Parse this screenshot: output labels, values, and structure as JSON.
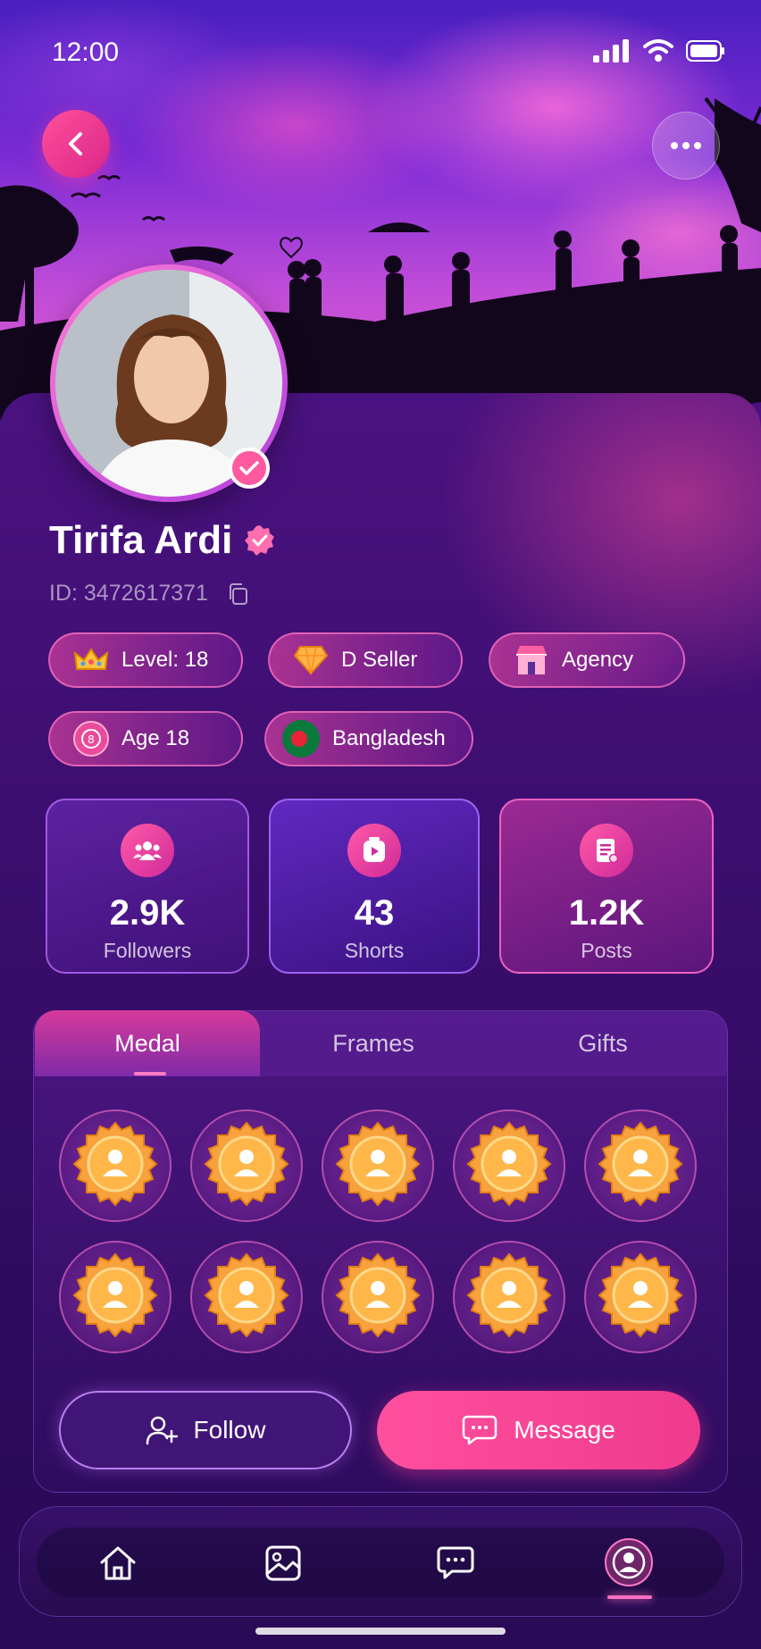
{
  "status_bar": {
    "time": "12:00"
  },
  "profile": {
    "name": "Tirifa Ardi",
    "id_text": "ID: 3472617371"
  },
  "chips": [
    {
      "label": "Level: 18",
      "icon": "crown-icon"
    },
    {
      "label": "D Seller",
      "icon": "diamond-icon"
    },
    {
      "label": "Agency",
      "icon": "store-icon"
    },
    {
      "label": "Age 18",
      "icon": "age-icon"
    },
    {
      "label": "Bangladesh",
      "icon": "flag-icon"
    }
  ],
  "stats": [
    {
      "value": "2.9K",
      "label": "Followers",
      "icon": "users-icon"
    },
    {
      "value": "43",
      "label": "Shorts",
      "icon": "video-icon"
    },
    {
      "value": "1.2K",
      "label": "Posts",
      "icon": "document-icon"
    }
  ],
  "tabs": [
    {
      "label": "Medal",
      "active": true
    },
    {
      "label": "Frames",
      "active": false
    },
    {
      "label": "Gifts",
      "active": false
    }
  ],
  "medals_count": 10,
  "actions": {
    "follow_label": "Follow",
    "message_label": "Message"
  },
  "nav": {
    "items": [
      "home-icon",
      "gallery-icon",
      "chat-icon",
      "profile-icon"
    ],
    "active": "profile-icon"
  },
  "colors": {
    "accent": "#ff4f9f",
    "background": "#3a0e6b",
    "badge": "#ff5aa0"
  }
}
